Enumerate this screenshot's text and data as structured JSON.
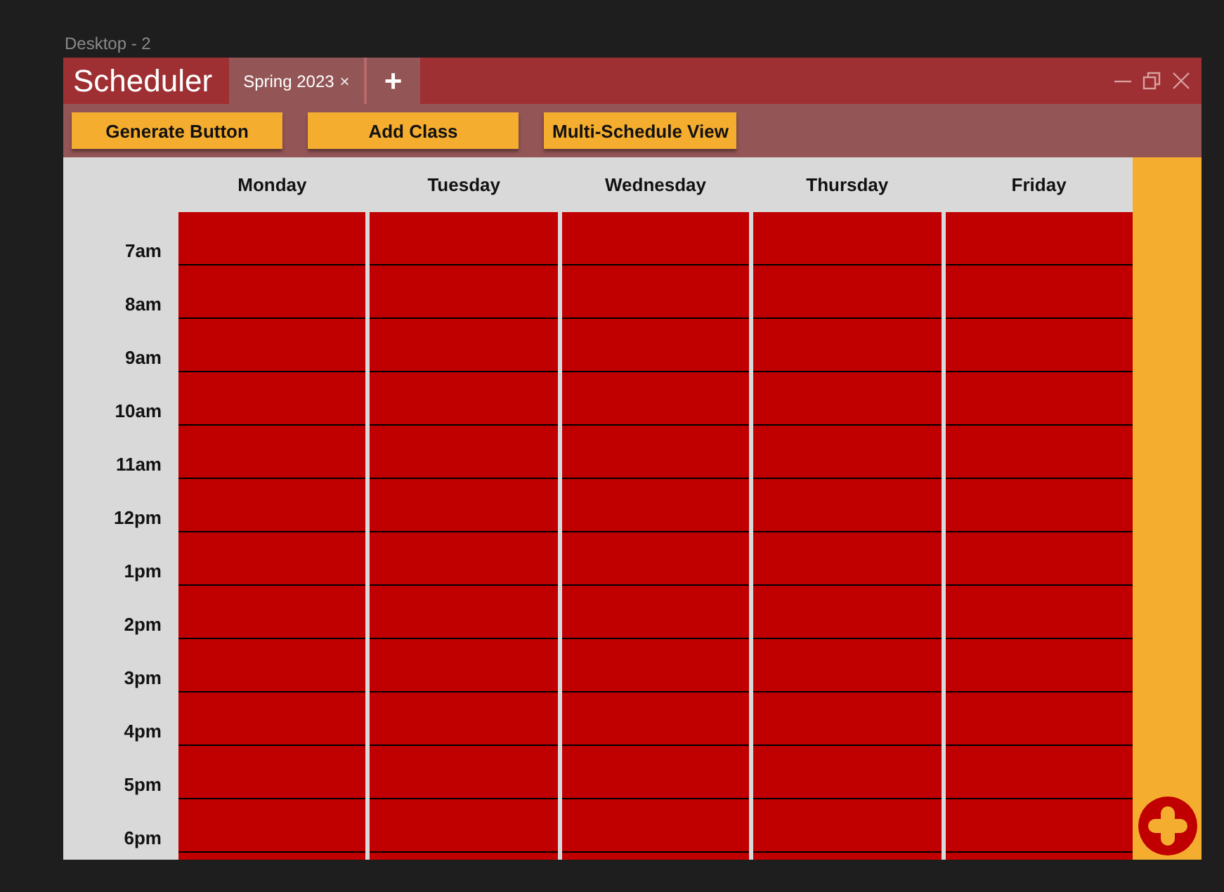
{
  "canvas_label": "Desktop - 2",
  "window": {
    "title": "Scheduler"
  },
  "tabs": [
    {
      "label": "Spring 2023",
      "close": "×",
      "selected": true
    }
  ],
  "new_tab": "+",
  "toolbar": [
    "Generate Button",
    "Add Class",
    "Multi-Schedule View"
  ],
  "days": [
    "Monday",
    "Tuesday",
    "Wednesday",
    "Thursday",
    "Friday"
  ],
  "times": [
    "7am",
    "8am",
    "9am",
    "10am",
    "11am",
    "12pm",
    "1pm",
    "2pm",
    "3pm",
    "4pm",
    "5pm",
    "6pm"
  ]
}
